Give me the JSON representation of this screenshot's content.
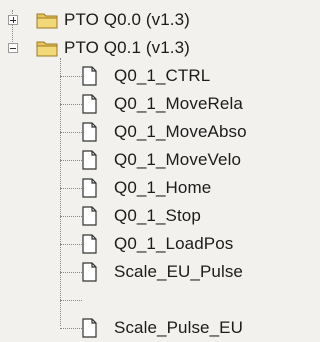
{
  "tree": {
    "nodes": [
      {
        "label": "PTO Q0.0 (v1.3)",
        "kind": "folder",
        "state": "collapsed"
      },
      {
        "label": "PTO Q0.1 (v1.3)",
        "kind": "folder",
        "state": "expanded"
      },
      {
        "label": "Q0_1_CTRL",
        "kind": "block"
      },
      {
        "label": "Q0_1_MoveRela",
        "kind": "block"
      },
      {
        "label": "Q0_1_MoveAbso",
        "kind": "block"
      },
      {
        "label": "Q0_1_MoveVelo",
        "kind": "block"
      },
      {
        "label": "Q0_1_Home",
        "kind": "block"
      },
      {
        "label": "Q0_1_Stop",
        "kind": "block"
      },
      {
        "label": "Q0_1_LoadPos",
        "kind": "block"
      },
      {
        "label": "Scale_EU_Pulse",
        "kind": "block"
      },
      {
        "label": "Scale_Pulse_EU",
        "kind": "block"
      }
    ]
  },
  "icons": {
    "folder": "folder-icon",
    "block": "program-block-icon",
    "expand": "plus-expander-icon",
    "collapse": "minus-expander-icon"
  },
  "colors": {
    "background": "#f2f1ee",
    "folder": "#e8c35a",
    "text": "#1c1c1c",
    "tree_line": "#888888"
  }
}
